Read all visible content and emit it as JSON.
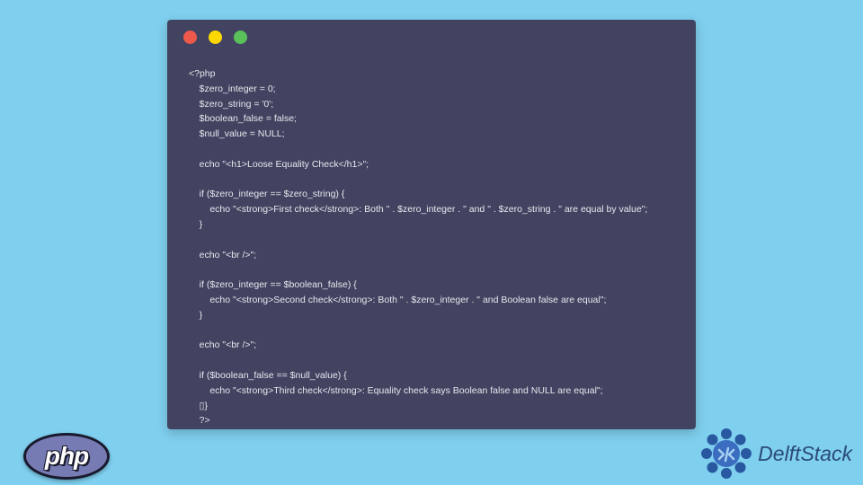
{
  "code": {
    "lines": [
      "<?php",
      "    $zero_integer = 0;",
      "    $zero_string = '0';",
      "    $boolean_false = false;",
      "    $null_value = NULL;",
      "",
      "    echo \"<h1>Loose Equality Check</h1>\";",
      "",
      "    if ($zero_integer == $zero_string) {",
      "        echo \"<strong>First check</strong>: Both \" . $zero_integer . \" and \" . $zero_string . \" are equal by value\";",
      "    }",
      "",
      "    echo \"<br />\";",
      "",
      "    if ($zero_integer == $boolean_false) {",
      "        echo \"<strong>Second check</strong>: Both \" . $zero_integer . \" and Boolean false are equal\";",
      "    }",
      "",
      "    echo \"<br />\";",
      "",
      "    if ($boolean_false == $null_value) {",
      "        echo \"<strong>Third check</strong>: Equality check says Boolean false and NULL are equal\";",
      "    ▯}",
      "    ?>"
    ]
  },
  "phpLogo": {
    "text": "php"
  },
  "delftLogo": {
    "text": "DelftStack"
  }
}
